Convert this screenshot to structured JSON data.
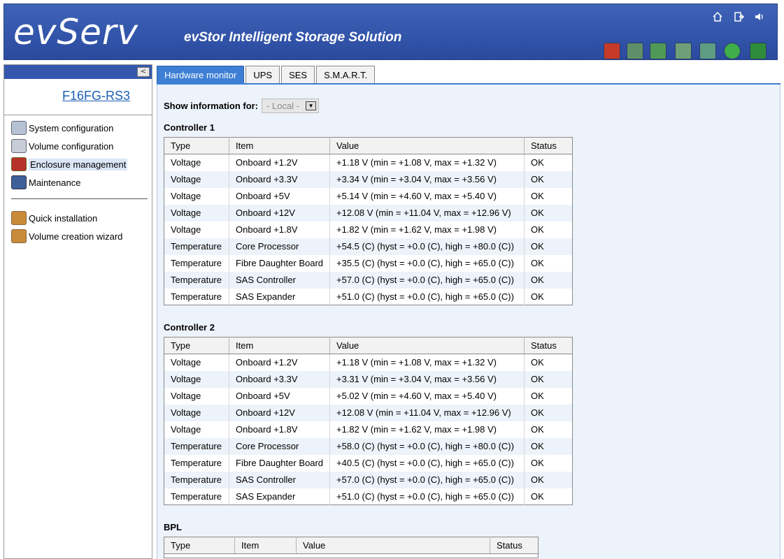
{
  "header": {
    "logo": "evServ",
    "product_title": "evStor Intelligent Storage Solution",
    "top_icons": [
      "home-icon",
      "logout-icon",
      "sound-icon"
    ],
    "toolbar_icons": [
      "alert-disk-icon",
      "temperature-icon",
      "network-icon",
      "storage-icon",
      "fan-icon",
      "power-icon",
      "board-icon"
    ]
  },
  "sidebar": {
    "device_name": "F16FG-RS3",
    "collapse_glyph": "<",
    "items": [
      {
        "label": "System configuration",
        "icon": "camera-icon"
      },
      {
        "label": "Volume configuration",
        "icon": "disks-icon"
      },
      {
        "label": "Enclosure management",
        "icon": "monitor-icon"
      },
      {
        "label": "Maintenance",
        "icon": "wrench-icon"
      },
      {
        "label": "Quick installation",
        "icon": "box-icon"
      },
      {
        "label": "Volume creation wizard",
        "icon": "wizard-icon"
      }
    ]
  },
  "tabs": [
    "Hardware monitor",
    "UPS",
    "SES",
    "S.M.A.R.T."
  ],
  "show_info": {
    "label": "Show information for:",
    "selected": "- Local -"
  },
  "columns": [
    "Type",
    "Item",
    "Value",
    "Status"
  ],
  "controllers": [
    {
      "title": "Controller 1",
      "rows": [
        [
          "Voltage",
          "Onboard +1.2V",
          "+1.18 V (min = +1.08 V, max = +1.32 V)",
          "OK"
        ],
        [
          "Voltage",
          "Onboard +3.3V",
          "+3.34 V (min = +3.04 V, max = +3.56 V)",
          "OK"
        ],
        [
          "Voltage",
          "Onboard +5V",
          "+5.14 V (min = +4.60 V, max = +5.40 V)",
          "OK"
        ],
        [
          "Voltage",
          "Onboard +12V",
          "+12.08 V (min = +11.04 V, max = +12.96 V)",
          "OK"
        ],
        [
          "Voltage",
          "Onboard +1.8V",
          "+1.82 V (min = +1.62 V, max = +1.98 V)",
          "OK"
        ],
        [
          "Temperature",
          "Core Processor",
          "+54.5 (C) (hyst = +0.0 (C), high = +80.0 (C))",
          "OK"
        ],
        [
          "Temperature",
          "Fibre Daughter Board",
          "+35.5 (C) (hyst = +0.0 (C), high = +65.0 (C))",
          "OK"
        ],
        [
          "Temperature",
          "SAS Controller",
          "+57.0 (C) (hyst = +0.0 (C), high = +65.0 (C))",
          "OK"
        ],
        [
          "Temperature",
          "SAS Expander",
          "+51.0 (C) (hyst = +0.0 (C), high = +65.0 (C))",
          "OK"
        ]
      ]
    },
    {
      "title": "Controller 2",
      "rows": [
        [
          "Voltage",
          "Onboard +1.2V",
          "+1.18 V (min = +1.08 V, max = +1.32 V)",
          "OK"
        ],
        [
          "Voltage",
          "Onboard +3.3V",
          "+3.31 V (min = +3.04 V, max = +3.56 V)",
          "OK"
        ],
        [
          "Voltage",
          "Onboard +5V",
          "+5.02 V (min = +4.60 V, max = +5.40 V)",
          "OK"
        ],
        [
          "Voltage",
          "Onboard +12V",
          "+12.08 V (min = +11.04 V, max = +12.96 V)",
          "OK"
        ],
        [
          "Voltage",
          "Onboard +1.8V",
          "+1.82 V (min = +1.62 V, max = +1.98 V)",
          "OK"
        ],
        [
          "Temperature",
          "Core Processor",
          "+58.0 (C) (hyst = +0.0 (C), high = +80.0 (C))",
          "OK"
        ],
        [
          "Temperature",
          "Fibre Daughter Board",
          "+40.5 (C) (hyst = +0.0 (C), high = +65.0 (C))",
          "OK"
        ],
        [
          "Temperature",
          "SAS Controller",
          "+57.0 (C) (hyst = +0.0 (C), high = +65.0 (C))",
          "OK"
        ],
        [
          "Temperature",
          "SAS Expander",
          "+51.0 (C) (hyst = +0.0 (C), high = +65.0 (C))",
          "OK"
        ]
      ]
    }
  ],
  "bpl": {
    "title": "BPL"
  },
  "colors": {
    "header_blue": "#3558ad",
    "tab_active": "#3d7fd4",
    "content_bg": "#edf3fb",
    "link": "#1a5fb4"
  }
}
